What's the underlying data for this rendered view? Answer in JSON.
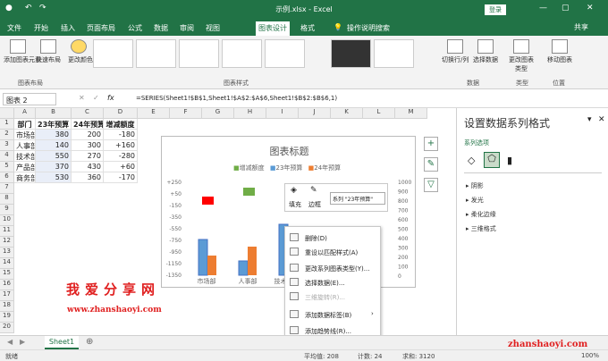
{
  "window": {
    "title": "示例.xlsx - Excel",
    "login": "登录",
    "minimize": "—",
    "restore": "▢",
    "close": "✕"
  },
  "qat": {
    "save": "💾",
    "undo": "↶",
    "redo": "↷"
  },
  "tabs": [
    "文件",
    "开始",
    "插入",
    "页面布局",
    "公式",
    "数据",
    "审阅",
    "视图",
    "图表设计",
    "格式"
  ],
  "tell_me": "操作说明搜索",
  "share": "共享",
  "ribbon": {
    "add_element": "添加图表元素",
    "quick_layout": "快速布局",
    "change_colors": "更改颜色",
    "group_layout": "图表布局",
    "group_styles": "图表样式",
    "switch_rowcol": "切换行/列",
    "select_data": "选择数据",
    "group_data": "数据",
    "change_type": "更改图表类型",
    "group_type": "类型",
    "move_chart": "移动图表",
    "group_location": "位置"
  },
  "namebox": "图表 2",
  "formula": "=SERIES(Sheet1!$B$1,Sheet1!$A$2:$A$6,Sheet1!$B$2:$B$6,1)",
  "fx": "fx",
  "columns": [
    "A",
    "B",
    "C",
    "D",
    "E",
    "F",
    "G",
    "H",
    "I",
    "J",
    "K",
    "L",
    "M"
  ],
  "rows": [
    "1",
    "2",
    "3",
    "4",
    "5",
    "6",
    "7",
    "8",
    "9",
    "10",
    "11",
    "12",
    "13",
    "14",
    "15",
    "16",
    "17",
    "18",
    "19",
    "20"
  ],
  "table": {
    "headers": [
      "部门",
      "23年预算",
      "24年预算",
      "增减额度"
    ],
    "rows": [
      [
        "市场部",
        "380",
        "200",
        "-180"
      ],
      [
        "人事部",
        "140",
        "300",
        "+160"
      ],
      [
        "技术部",
        "550",
        "270",
        "-280"
      ],
      [
        "产品部",
        "370",
        "430",
        "+60"
      ],
      [
        "商务部",
        "530",
        "360",
        "-170"
      ]
    ]
  },
  "chart_data": {
    "type": "bar",
    "title": "图表标题",
    "categories": [
      "市场部",
      "人事部",
      "技术部"
    ],
    "series": [
      {
        "name": "增减额度",
        "color": "#70ad47"
      },
      {
        "name": "23年预算",
        "color": "#5b9bd5"
      },
      {
        "name": "24年预算",
        "color": "#ed7d31"
      }
    ],
    "left_ticks": [
      "+250",
      "+50",
      "-150",
      "-350",
      "-550",
      "-750",
      "-950",
      "-1150",
      "-1350"
    ],
    "right_ticks": [
      "1000",
      "900",
      "800",
      "700",
      "600",
      "500",
      "400",
      "300",
      "200",
      "100",
      "0"
    ]
  },
  "mini_toolbar": {
    "fill": "填充",
    "outline": "边框",
    "series": "系列 \"23年预算\""
  },
  "context_menu": [
    {
      "label": "删除(D)",
      "disabled": false
    },
    {
      "label": "重设以匹配样式(A)",
      "disabled": false
    },
    {
      "label": "更改系列图表类型(Y)...",
      "disabled": false
    },
    {
      "label": "选择数据(E)...",
      "disabled": false
    },
    {
      "label": "三维旋转(R)...",
      "disabled": true
    },
    {
      "label": "添加数据标签(B)",
      "disabled": false
    },
    {
      "label": "添加趋势线(R)...",
      "disabled": false
    },
    {
      "label": "设置数据系列格式(F)...",
      "disabled": false
    }
  ],
  "pane": {
    "title": "设置数据系列格式",
    "options": "系列选项",
    "sections": [
      "阴影",
      "发光",
      "柔化边缘",
      "三维格式"
    ]
  },
  "sheet": {
    "name": "Sheet1",
    "add": "⊕"
  },
  "status": {
    "ready": "就绪",
    "average": "平均值: 208",
    "count": "计数: 24",
    "sum": "求和: 3120",
    "zoom": "100%"
  },
  "watermark": {
    "cn": "我爱分享网",
    "url": "www.zhanshaoyi.com",
    "url2": "zhanshaoyi.com"
  }
}
